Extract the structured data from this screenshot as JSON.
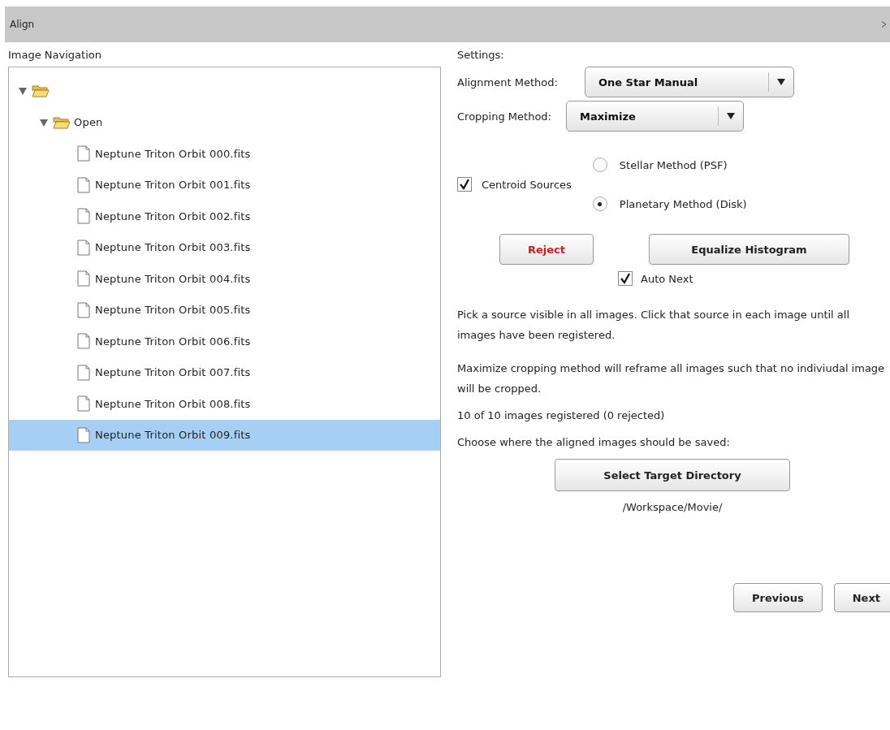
{
  "window": {
    "title": "Align"
  },
  "navigation": {
    "heading": "Image Navigation",
    "tree": [
      {
        "kind": "folder",
        "expanded": true,
        "selected": false,
        "children": [
          {
            "kind": "folder",
            "label": "Open",
            "expanded": true,
            "selected": false,
            "children": [
              {
                "kind": "file",
                "label": "Neptune Triton Orbit 000.fits",
                "selected": false
              },
              {
                "kind": "file",
                "label": "Neptune Triton Orbit 001.fits",
                "selected": false
              },
              {
                "kind": "file",
                "label": "Neptune Triton Orbit 002.fits",
                "selected": false
              },
              {
                "kind": "file",
                "label": "Neptune Triton Orbit 003.fits",
                "selected": false
              },
              {
                "kind": "file",
                "label": "Neptune Triton Orbit 004.fits",
                "selected": false
              },
              {
                "kind": "file",
                "label": "Neptune Triton Orbit 005.fits",
                "selected": false
              },
              {
                "kind": "file",
                "label": "Neptune Triton Orbit 006.fits",
                "selected": false
              },
              {
                "kind": "file",
                "label": "Neptune Triton Orbit 007.fits",
                "selected": false
              },
              {
                "kind": "file",
                "label": "Neptune Triton Orbit 008.fits",
                "selected": false
              },
              {
                "kind": "file",
                "label": "Neptune Triton Orbit 009.fits",
                "selected": true
              }
            ]
          }
        ]
      }
    ]
  },
  "settings": {
    "heading": "Settings:",
    "alignment_method": {
      "label": "Alignment Method:",
      "value": "One Star Manual"
    },
    "cropping_method": {
      "label": "Cropping Method:",
      "value": "Maximize"
    },
    "centroid_sources": {
      "label": "Centroid Sources",
      "checked": true
    },
    "methods": [
      {
        "label": "Stellar Method (PSF)",
        "selected": false
      },
      {
        "label": "Planetary Method (Disk)",
        "selected": true
      }
    ],
    "reject_button": "Reject",
    "equalize_button": "Equalize Histogram",
    "auto_next": {
      "label": "Auto Next",
      "checked": true
    },
    "instructions": [
      "Pick a source visible in all images. Click that source in each image until all images have been registered.",
      "Maximize cropping method will reframe all images such that no indiviudal image will be cropped."
    ],
    "status": "10 of 10 images registered  (0 rejected)",
    "save_prompt": "Choose where the aligned images should be saved:",
    "target_button": "Select Target Directory",
    "target_path": "/Workspace/Movie/"
  },
  "footer": {
    "buttons": [
      "Previous",
      "Next"
    ]
  }
}
